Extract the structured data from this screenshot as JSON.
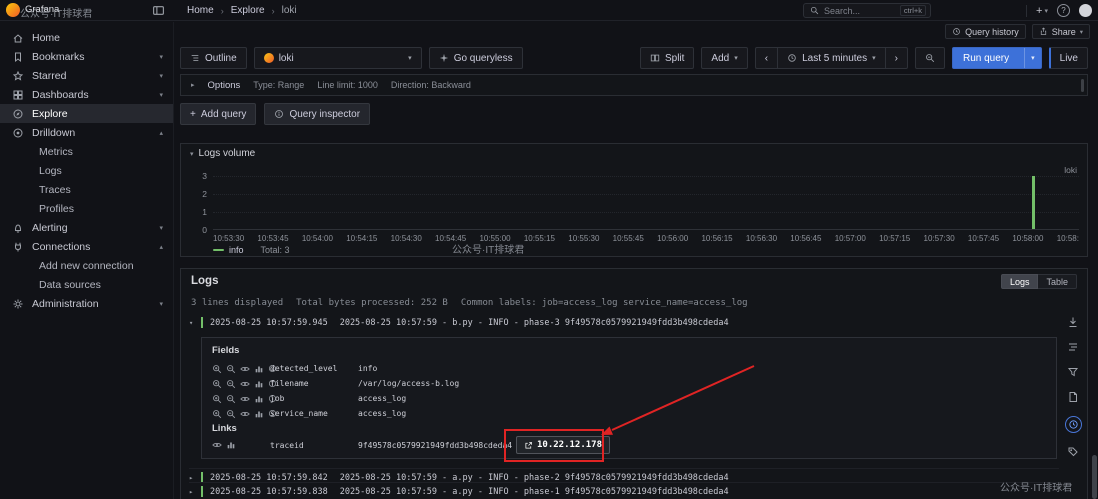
{
  "watermark": {
    "text": "公众号·IT排球君"
  },
  "brand": {
    "name": "Grafana"
  },
  "icons": {
    "plus": "+",
    "caret_down": "▾",
    "chevron_down": "▾",
    "chevron_up": "▴",
    "chevron_right": "▸",
    "chevron_left": "‹",
    "breadcrumb_sep": "›",
    "question": "?"
  },
  "topnav": {
    "breadcrumb": [
      {
        "label": "Home"
      },
      {
        "label": "Explore"
      },
      {
        "label": "loki"
      }
    ],
    "search": {
      "placeholder": "Search...",
      "shortcut": "ctrl+k"
    }
  },
  "actionbar": {
    "query_history": "Query history",
    "share": "Share"
  },
  "sidebar": {
    "items": [
      {
        "label": "Home"
      },
      {
        "label": "Bookmarks"
      },
      {
        "label": "Starred"
      },
      {
        "label": "Dashboards"
      },
      {
        "label": "Explore"
      },
      {
        "label": "Drilldown"
      },
      {
        "label": "Metrics"
      },
      {
        "label": "Logs"
      },
      {
        "label": "Traces"
      },
      {
        "label": "Profiles"
      },
      {
        "label": "Alerting"
      },
      {
        "label": "Connections"
      },
      {
        "label": "Add new connection"
      },
      {
        "label": "Data sources"
      },
      {
        "label": "Administration"
      }
    ]
  },
  "toolbar": {
    "outline": "Outline",
    "datasource": "loki",
    "go_queryless": "Go queryless",
    "split": "Split",
    "add": "Add",
    "time_range": "Last 5 minutes",
    "run_query": "Run query",
    "live": "Live"
  },
  "query_editor": {
    "options_label": "Options",
    "options_summary": [
      "Type: Range",
      "Line limit: 1000",
      "Direction: Backward"
    ],
    "add_query": "Add query",
    "query_inspector": "Query inspector"
  },
  "chart_data": {
    "type": "bar",
    "title": "Logs volume",
    "right_label": "loki",
    "legend": {
      "series": "info",
      "total": "Total: 3"
    },
    "ylim": [
      0,
      3
    ],
    "y_ticks": [
      "3",
      "2",
      "1",
      "0"
    ],
    "x_ticks": [
      "10:53:30",
      "10:53:45",
      "10:54:00",
      "10:54:15",
      "10:54:30",
      "10:54:45",
      "10:55:00",
      "10:55:15",
      "10:55:30",
      "10:55:45",
      "10:56:00",
      "10:56:15",
      "10:56:30",
      "10:56:45",
      "10:57:00",
      "10:57:15",
      "10:57:30",
      "10:57:45",
      "10:58:00",
      "10:58:"
    ],
    "series": [
      {
        "name": "info",
        "color": "#73bf69",
        "points": [
          {
            "x": "10:58:00",
            "y": 3
          }
        ]
      }
    ]
  },
  "logs": {
    "title": "Logs",
    "meta": {
      "lines": "3 lines displayed",
      "bytes": "Total bytes processed: 252 B",
      "common_labels_label": "Common labels:",
      "common_labels": "job=access_log service_name=access_log"
    },
    "toggle": {
      "logs": "Logs",
      "table": "Table"
    },
    "rows": [
      {
        "time": "2025-08-25 10:57:59.945",
        "body": "2025-08-25 10:57:59 - b.py - INFO - phase-3 9f49578c0579921949fdd3b498cdeda4"
      },
      {
        "time": "2025-08-25 10:57:59.842",
        "body": "2025-08-25 10:57:59 - a.py - INFO - phase-2 9f49578c0579921949fdd3b498cdeda4"
      },
      {
        "time": "2025-08-25 10:57:59.838",
        "body": "2025-08-25 10:57:59 - a.py - INFO - phase-1 9f49578c0579921949fdd3b498cdeda4"
      }
    ],
    "details": {
      "fields_label": "Fields",
      "fields": [
        {
          "name": "detected_level",
          "value": "info"
        },
        {
          "name": "filename",
          "value": "/var/log/access-b.log"
        },
        {
          "name": "job",
          "value": "access_log"
        },
        {
          "name": "service_name",
          "value": "access_log"
        }
      ],
      "links_label": "Links",
      "links": [
        {
          "name": "traceid",
          "value": "9f49578c0579921949fdd3b498cdeda4",
          "button": "10.22.12.178"
        }
      ]
    }
  }
}
